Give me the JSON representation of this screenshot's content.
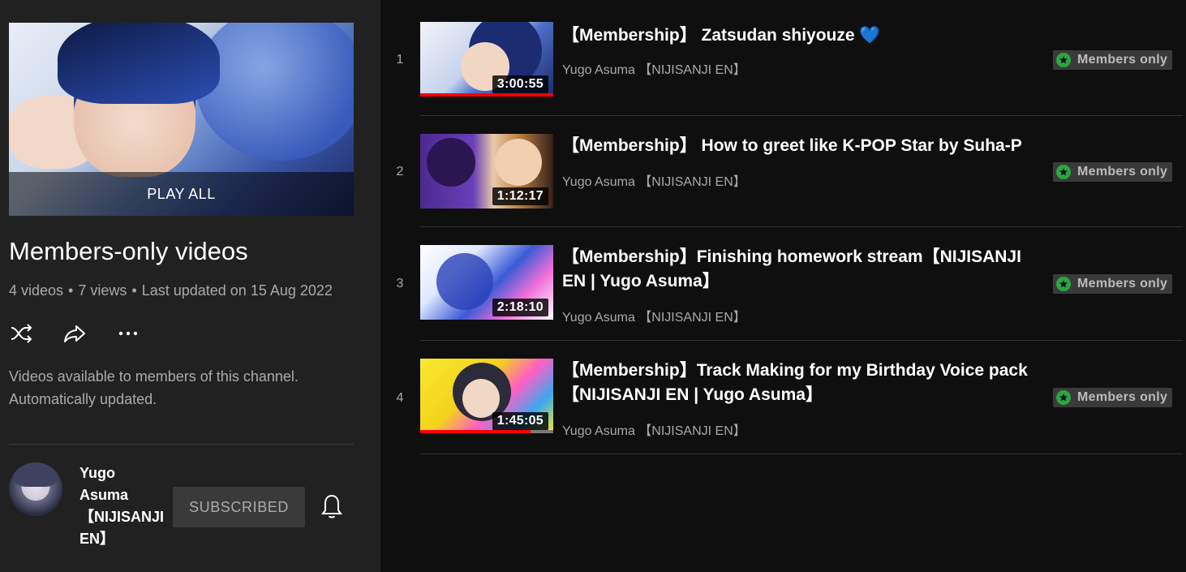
{
  "playlist": {
    "play_all_label": "PLAY ALL",
    "title": "Members-only videos",
    "video_count": "4 videos",
    "views": "7 views",
    "updated": "Last updated on 15 Aug 2022",
    "description_line1": "Videos available to members of this channel.",
    "description_line2": "Automatically updated.",
    "actions": [
      "shuffle-icon",
      "share-icon",
      "more-icon"
    ]
  },
  "owner": {
    "name": "Yugo Asuma【NIJISANJI EN】",
    "subscribe_label": "SUBSCRIBED"
  },
  "videos": [
    {
      "index": "1",
      "title": "【Membership】 Zatsudan shiyouze 💙",
      "channel": "Yugo Asuma 【NIJISANJI EN】",
      "duration": "3:00:55",
      "badge": "Members only",
      "watched_fraction": 1.0
    },
    {
      "index": "2",
      "title": "【Membership】 How to greet like K-POP Star by Suha-P",
      "channel": "Yugo Asuma 【NIJISANJI EN】",
      "duration": "1:12:17",
      "badge": "Members only",
      "watched_fraction": 0
    },
    {
      "index": "3",
      "title": "【Membership】Finishing homework stream【NIJISANJI EN | Yugo Asuma】",
      "channel": "Yugo Asuma 【NIJISANJI EN】",
      "duration": "2:18:10",
      "badge": "Members only",
      "watched_fraction": 0
    },
    {
      "index": "4",
      "title": "【Membership】Track Making for my Birthday Voice pack 【NIJISANJI EN | Yugo Asuma】",
      "channel": "Yugo Asuma 【NIJISANJI EN】",
      "duration": "1:45:05",
      "badge": "Members only",
      "watched_fraction": 0.83
    }
  ],
  "colors": {
    "background": "#0f0f0f",
    "panel": "#212121",
    "progress": "#ff0000",
    "members_badge_star": "#2ba640"
  }
}
